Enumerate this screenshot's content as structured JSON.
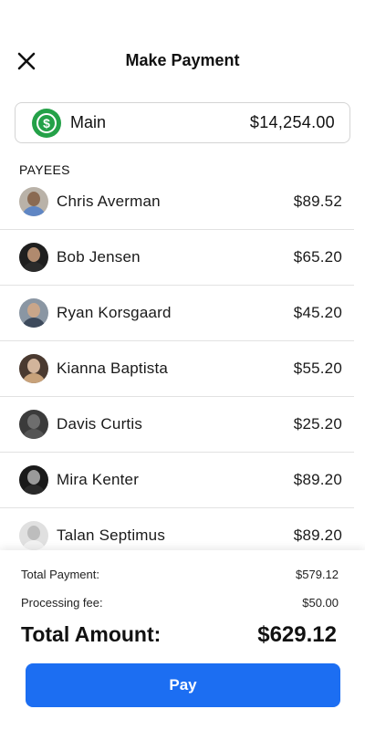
{
  "header": {
    "title": "Make Payment",
    "close_icon": "close-icon"
  },
  "account": {
    "name": "Main",
    "balance": "$14,254.00",
    "icon": "dollar-circle-icon",
    "icon_color": "#24a148"
  },
  "payees_label": "PAYEES",
  "payees": [
    {
      "name": "Chris Averman",
      "amount": "$89.52",
      "avatar_bg": "#b9b2a8",
      "skin": "#8a6a52",
      "shirt": "#5f86c4"
    },
    {
      "name": "Bob Jensen",
      "amount": "$65.20",
      "avatar_bg": "#1f1f1f",
      "skin": "#b08a6e",
      "shirt": "#2b2b2b"
    },
    {
      "name": "Ryan Korsgaard",
      "amount": "$45.20",
      "avatar_bg": "#8a96a3",
      "skin": "#c9a68a",
      "shirt": "#3d4a5c"
    },
    {
      "name": "Kianna Baptista",
      "amount": "$55.20",
      "avatar_bg": "#4a3a30",
      "skin": "#d2b49b",
      "shirt": "#c8a27a"
    },
    {
      "name": "Davis Curtis",
      "amount": "$25.20",
      "avatar_bg": "#3b3b3b",
      "skin": "#6e6e6e",
      "shirt": "#555555"
    },
    {
      "name": "Mira Kenter",
      "amount": "$89.20",
      "avatar_bg": "#1a1a1a",
      "skin": "#9a9a9a",
      "shirt": "#2a2a2a"
    },
    {
      "name": "Talan Septimus",
      "amount": "$89.20",
      "avatar_bg": "#e0e0e0",
      "skin": "#bdbdbd",
      "shirt": "#f2f2f2"
    }
  ],
  "summary": {
    "total_payment_label": "Total Payment:",
    "total_payment_value": "$579.12",
    "fee_label": "Processing fee:",
    "fee_value": "$50.00",
    "total_amount_label": "Total Amount:",
    "total_amount_value": "$629.12"
  },
  "pay_button": {
    "label": "Pay",
    "color": "#1c6ef2"
  }
}
